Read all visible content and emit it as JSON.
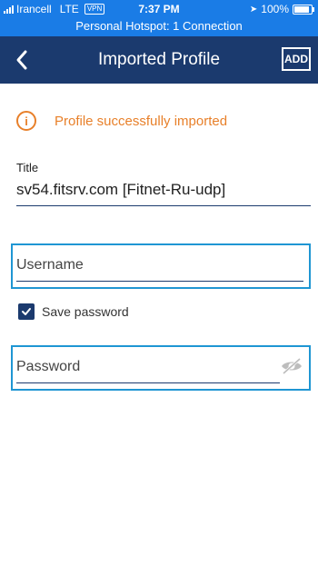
{
  "status_bar": {
    "carrier": "Irancell",
    "network": "LTE",
    "vpn": "VPN",
    "time": "7:37 PM",
    "battery": "100%",
    "battery_level": 1.0
  },
  "hotspot": {
    "text": "Personal Hotspot: 1 Connection"
  },
  "nav": {
    "title": "Imported Profile",
    "add_label": "ADD",
    "back_icon": "chevron-left-icon"
  },
  "notice": {
    "text": "Profile successfully imported",
    "icon": "info-icon"
  },
  "form": {
    "title_label": "Title",
    "title_value": "sv54.fitsrv.com [Fitnet-Ru-udp]",
    "username_placeholder": "Username",
    "username_value": "",
    "save_password_label": "Save password",
    "save_password_checked": true,
    "password_placeholder": "Password",
    "password_value": ""
  },
  "colors": {
    "status_bar": "#1a7ce6",
    "nav_bar": "#1b3a6e",
    "accent_orange": "#e8802a",
    "field_highlight": "#1f96d3"
  }
}
